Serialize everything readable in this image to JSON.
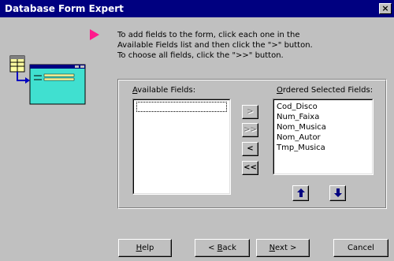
{
  "window": {
    "title": "Database Form Expert",
    "close_glyph": "×"
  },
  "instructions": {
    "line1": "To add fields to the form, click each one in the",
    "line2": "Available Fields list and then click the \">\" button.",
    "line3": "To choose all fields, click the \">>\" button."
  },
  "available": {
    "label_hotkey": "A",
    "label_rest": "vailable Fields:",
    "items": []
  },
  "ordered": {
    "label_hotkey": "O",
    "label_rest": "rdered Selected Fields:",
    "items": [
      "Cod_Disco",
      "Num_Faixa",
      "Nom_Musica",
      "Nom_Autor",
      "Tmp_Musica"
    ]
  },
  "move_buttons": {
    "add": ">",
    "add_all": ">>",
    "remove": "<",
    "remove_all": "<<"
  },
  "footer": {
    "help_hotkey": "H",
    "help_rest": "elp",
    "back_prefix": "< ",
    "back_hotkey": "B",
    "back_rest": "ack",
    "next_hotkey": "N",
    "next_rest": "ext >",
    "cancel": "Cancel"
  },
  "colors": {
    "titlebar": "#000080",
    "pointer": "#ff1a8c",
    "face": "#c0c0c0",
    "illustration": "#40e0d0"
  }
}
